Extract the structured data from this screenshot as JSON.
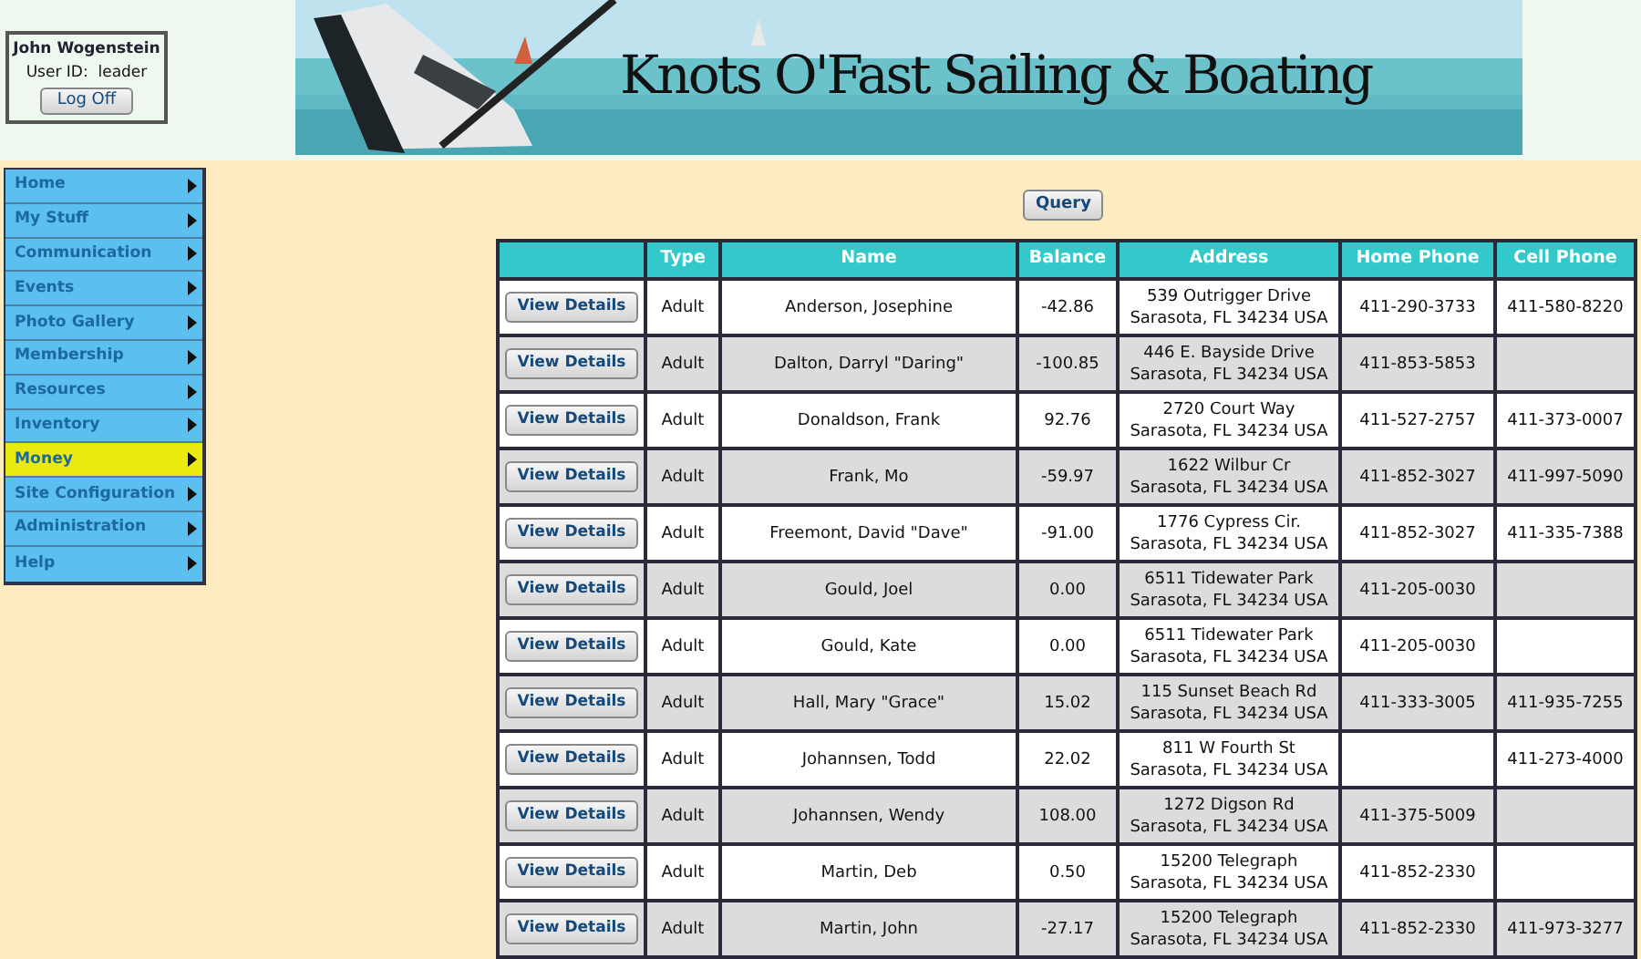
{
  "user": {
    "name": "John Wogenstein",
    "user_id_label": "User ID:",
    "user_id": "leader",
    "logoff": "Log Off"
  },
  "banner": {
    "title": "Knots O'Fast Sailing & Boating"
  },
  "menu": [
    {
      "label": "Home",
      "selected": false
    },
    {
      "label": "My Stuff",
      "selected": false
    },
    {
      "label": "Communication",
      "selected": false
    },
    {
      "label": "Events",
      "selected": false
    },
    {
      "label": "Photo Gallery",
      "selected": false
    },
    {
      "label": "Membership",
      "selected": false
    },
    {
      "label": "Resources",
      "selected": false
    },
    {
      "label": "Inventory",
      "selected": false
    },
    {
      "label": "Money",
      "selected": true
    },
    {
      "label": "Site Configuration",
      "selected": false
    },
    {
      "label": "Administration",
      "selected": false
    },
    {
      "label": "Help",
      "selected": false
    }
  ],
  "query_button": "Query",
  "table": {
    "columns": [
      "",
      "Type",
      "Name",
      "Balance",
      "Address",
      "Home Phone",
      "Cell Phone"
    ],
    "rows": [
      {
        "button": "View Details",
        "type": "Adult",
        "name": "Anderson, Josephine",
        "balance": "-42.86",
        "address": [
          "539 Outrigger Drive",
          "Sarasota, FL 34234 USA"
        ],
        "home": "411-290-3733",
        "cell": "411-580-8220"
      },
      {
        "button": "View Details",
        "type": "Adult",
        "name": "Dalton, Darryl \"Daring\"",
        "balance": "-100.85",
        "address": [
          "446 E. Bayside Drive",
          "Sarasota, FL 34234 USA"
        ],
        "home": "411-853-5853",
        "cell": ""
      },
      {
        "button": "View Details",
        "type": "Adult",
        "name": "Donaldson, Frank",
        "balance": "92.76",
        "address": [
          "2720 Court Way",
          "Sarasota, FL 34234 USA"
        ],
        "home": "411-527-2757",
        "cell": "411-373-0007"
      },
      {
        "button": "View Details",
        "type": "Adult",
        "name": "Frank, Mo",
        "balance": "-59.97",
        "address": [
          "1622 Wilbur Cr",
          "Sarasota, FL 34234 USA"
        ],
        "home": "411-852-3027",
        "cell": "411-997-5090"
      },
      {
        "button": "View Details",
        "type": "Adult",
        "name": "Freemont, David \"Dave\"",
        "balance": "-91.00",
        "address": [
          "1776 Cypress Cir.",
          "Sarasota, FL 34234 USA"
        ],
        "home": "411-852-3027",
        "cell": "411-335-7388"
      },
      {
        "button": "View Details",
        "type": "Adult",
        "name": "Gould, Joel",
        "balance": "0.00",
        "address": [
          "6511 Tidewater Park",
          "Sarasota, FL 34234 USA"
        ],
        "home": "411-205-0030",
        "cell": ""
      },
      {
        "button": "View Details",
        "type": "Adult",
        "name": "Gould, Kate",
        "balance": "0.00",
        "address": [
          "6511 Tidewater Park",
          "Sarasota, FL 34234 USA"
        ],
        "home": "411-205-0030",
        "cell": ""
      },
      {
        "button": "View Details",
        "type": "Adult",
        "name": "Hall, Mary \"Grace\"",
        "balance": "15.02",
        "address": [
          "115 Sunset Beach Rd",
          "Sarasota, FL 34234 USA"
        ],
        "home": "411-333-3005",
        "cell": "411-935-7255"
      },
      {
        "button": "View Details",
        "type": "Adult",
        "name": "Johannsen, Todd",
        "balance": "22.02",
        "address": [
          "811 W Fourth St",
          "Sarasota, FL 34234 USA"
        ],
        "home": "",
        "cell": "411-273-4000"
      },
      {
        "button": "View Details",
        "type": "Adult",
        "name": "Johannsen, Wendy",
        "balance": "108.00",
        "address": [
          "1272 Digson Rd",
          "Sarasota, FL 34234 USA"
        ],
        "home": "411-375-5009",
        "cell": ""
      },
      {
        "button": "View Details",
        "type": "Adult",
        "name": "Martin, Deb",
        "balance": "0.50",
        "address": [
          "15200 Telegraph",
          "Sarasota, FL 34234 USA"
        ],
        "home": "411-852-2330",
        "cell": ""
      },
      {
        "button": "View Details",
        "type": "Adult",
        "name": "Martin, John",
        "balance": "-27.17",
        "address": [
          "15200 Telegraph",
          "Sarasota, FL 34234 USA"
        ],
        "home": "411-852-2330",
        "cell": "411-973-3277"
      }
    ]
  }
}
